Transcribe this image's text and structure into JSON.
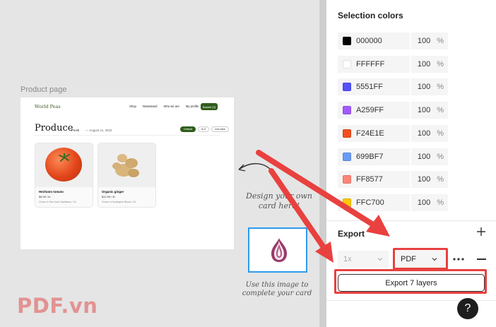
{
  "canvas": {
    "frame_label": "Product page",
    "site": {
      "logo": "World Peas",
      "nav": [
        "Shop",
        "Newsstand",
        "Who we are",
        "My profile"
      ],
      "cart_button": "Basket (3)",
      "page_title": "Produce",
      "fresh_label": "Fresh",
      "date": "— August 21, 2023",
      "sort_pills": [
        "Default",
        "A-Z",
        "List view"
      ],
      "products": [
        {
          "name": "Heirloom tomato",
          "price": "$5.99 / lb",
          "origin": "Grown in San Juan Capistrano, CA"
        },
        {
          "name": "Organic ginger",
          "price": "$12.99 / lb",
          "origin": "Grown in Huntington Beach, CA"
        }
      ]
    },
    "design_note": "Design your own card here!",
    "use_image_note": "Use this image to complete your card"
  },
  "panel": {
    "selection_colors_title": "Selection colors",
    "colors": [
      {
        "hex": "000000",
        "opacity": "100",
        "swatch": "#000000"
      },
      {
        "hex": "FFFFFF",
        "opacity": "100",
        "swatch": "#FFFFFF"
      },
      {
        "hex": "5551FF",
        "opacity": "100",
        "swatch": "#5551FF"
      },
      {
        "hex": "A259FF",
        "opacity": "100",
        "swatch": "#A259FF"
      },
      {
        "hex": "F24E1E",
        "opacity": "100",
        "swatch": "#F24E1E"
      },
      {
        "hex": "699BF7",
        "opacity": "100",
        "swatch": "#699BF7"
      },
      {
        "hex": "FF8577",
        "opacity": "100",
        "swatch": "#FF8577"
      },
      {
        "hex": "FFC700",
        "opacity": "100",
        "swatch": "#FFC700"
      }
    ],
    "percent_sign": "%",
    "export": {
      "title": "Export",
      "scale": "1x",
      "format": "PDF",
      "button": "Export 7 layers"
    },
    "help": "?"
  },
  "watermark": "PDF.vn",
  "accent": {
    "highlight": "#E8413F",
    "selection": "#2D9BF0",
    "brand_green": "#2F5D1C"
  }
}
